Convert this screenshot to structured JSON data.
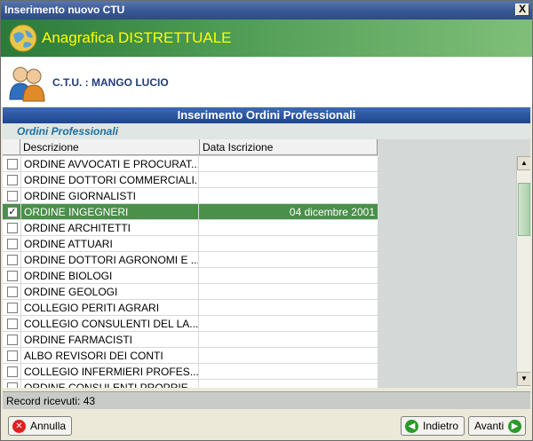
{
  "window": {
    "title": "Inserimento nuovo CTU",
    "close_label": "X"
  },
  "banner": {
    "title": "Anagrafica DISTRETTUALE",
    "icon": "globe-icon"
  },
  "ctu": {
    "label": "C.T.U. : MANGO LUCIO",
    "icon": "users-icon"
  },
  "section": {
    "title": "Inserimento Ordini Professionali",
    "subtitle": "Ordini Professionali"
  },
  "grid": {
    "columns": [
      "Descrizione",
      "Data Iscrizione"
    ],
    "rows": [
      {
        "checked": false,
        "desc": "ORDINE AVVOCATI E PROCURAT...",
        "date": ""
      },
      {
        "checked": false,
        "desc": "ORDINE DOTTORI COMMERCIALI...",
        "date": ""
      },
      {
        "checked": false,
        "desc": "ORDINE GIORNALISTI",
        "date": ""
      },
      {
        "checked": true,
        "desc": "ORDINE INGEGNERI",
        "date": "04 dicembre 2001"
      },
      {
        "checked": false,
        "desc": "ORDINE ARCHITETTI",
        "date": ""
      },
      {
        "checked": false,
        "desc": "ORDINE ATTUARI",
        "date": ""
      },
      {
        "checked": false,
        "desc": "ORDINE DOTTORI AGRONOMI E ...",
        "date": ""
      },
      {
        "checked": false,
        "desc": "ORDINE BIOLOGI",
        "date": ""
      },
      {
        "checked": false,
        "desc": "ORDINE GEOLOGI",
        "date": ""
      },
      {
        "checked": false,
        "desc": "COLLEGIO PERITI AGRARI",
        "date": ""
      },
      {
        "checked": false,
        "desc": "COLLEGIO CONSULENTI DEL LA...",
        "date": ""
      },
      {
        "checked": false,
        "desc": "ORDINE FARMACISTI",
        "date": ""
      },
      {
        "checked": false,
        "desc": "ALBO REVISORI DEI CONTI",
        "date": ""
      },
      {
        "checked": false,
        "desc": "COLLEGIO INFERMIERI PROFES...",
        "date": ""
      },
      {
        "checked": false,
        "desc": "ORDINE CONSULENTI PROPRIE...",
        "date": ""
      }
    ],
    "selected_row_color": "#4a8f4a"
  },
  "status": {
    "text": "Record ricevuti: 43"
  },
  "buttons": {
    "annulla": "Annulla",
    "indietro": "Indietro",
    "avanti": "Avanti"
  }
}
